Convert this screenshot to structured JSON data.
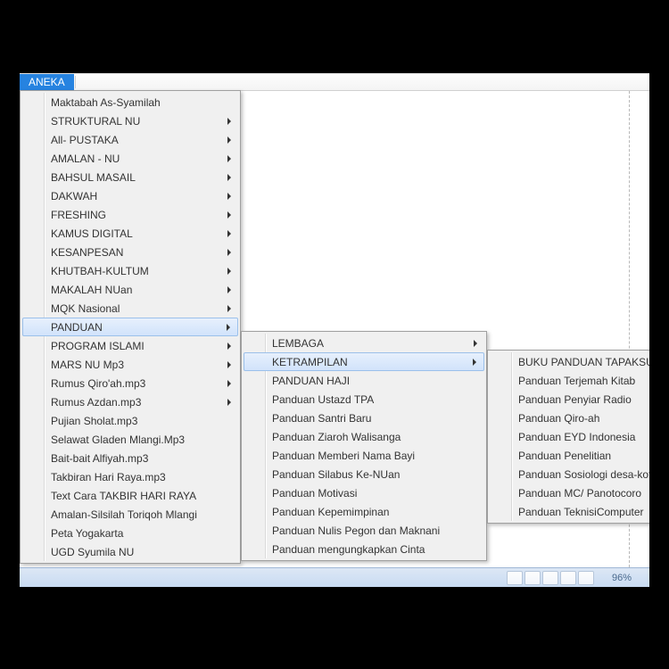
{
  "menubar": {
    "active": "ANEKA"
  },
  "menu1": {
    "items": [
      {
        "label": "Maktabah As-Syamilah",
        "arrow": false
      },
      {
        "label": "STRUKTURAL NU",
        "arrow": true
      },
      {
        "label": "All- PUSTAKA",
        "arrow": true
      },
      {
        "label": "AMALAN - NU",
        "arrow": true
      },
      {
        "label": "BAHSUL MASAIL",
        "arrow": true
      },
      {
        "label": "DAKWAH",
        "arrow": true
      },
      {
        "label": "FRESHING",
        "arrow": true
      },
      {
        "label": "KAMUS DIGITAL",
        "arrow": true
      },
      {
        "label": "KESANPESAN",
        "arrow": true
      },
      {
        "label": "KHUTBAH-KULTUM",
        "arrow": true
      },
      {
        "label": "MAKALAH NUan",
        "arrow": true
      },
      {
        "label": "MQK Nasional",
        "arrow": true
      },
      {
        "label": "PANDUAN",
        "arrow": true,
        "highlight": true
      },
      {
        "label": "PROGRAM ISLAMI",
        "arrow": true
      },
      {
        "label": "MARS NU Mp3",
        "arrow": true
      },
      {
        "label": "Rumus Qiro'ah.mp3",
        "arrow": true
      },
      {
        "label": "Rumus Azdan.mp3",
        "arrow": true
      },
      {
        "label": "Pujian Sholat.mp3",
        "arrow": false
      },
      {
        "label": "Selawat Gladen Mlangi.Mp3",
        "arrow": false
      },
      {
        "label": "Bait-bait Alfiyah.mp3",
        "arrow": false
      },
      {
        "label": "Takbiran Hari Raya.mp3",
        "arrow": false
      },
      {
        "label": "Text Cara TAKBIR HARI RAYA",
        "arrow": false
      },
      {
        "label": "Amalan-Silsilah Toriqoh Mlangi",
        "arrow": false
      },
      {
        "label": "Peta Yogakarta",
        "arrow": false
      },
      {
        "label": "UGD Syumila NU",
        "arrow": false
      }
    ]
  },
  "menu2": {
    "items": [
      {
        "label": "LEMBAGA",
        "arrow": true
      },
      {
        "label": "KETRAMPILAN",
        "arrow": true,
        "highlight": true
      },
      {
        "label": "PANDUAN HAJI",
        "arrow": false
      },
      {
        "label": "Panduan Ustazd TPA",
        "arrow": false
      },
      {
        "label": "Panduan Santri Baru",
        "arrow": false
      },
      {
        "label": "Panduan Ziaroh Walisanga",
        "arrow": false
      },
      {
        "label": "Panduan Memberi Nama Bayi",
        "arrow": false
      },
      {
        "label": "Panduan Silabus Ke-NUan",
        "arrow": false
      },
      {
        "label": "Panduan Motivasi",
        "arrow": false
      },
      {
        "label": "Panduan Kepemimpinan",
        "arrow": false
      },
      {
        "label": "Panduan Nulis Pegon dan Maknani",
        "arrow": false
      },
      {
        "label": "Panduan mengungkapkan Cinta",
        "arrow": false
      }
    ]
  },
  "menu3": {
    "items": [
      {
        "label": "BUKU PANDUAN TAPAKSUCI",
        "arrow": false
      },
      {
        "label": "Panduan Terjemah Kitab",
        "arrow": false
      },
      {
        "label": "Panduan Penyiar Radio",
        "arrow": false
      },
      {
        "label": "Panduan Qiro-ah",
        "arrow": false
      },
      {
        "label": "Panduan EYD Indonesia",
        "arrow": false
      },
      {
        "label": "Panduan Penelitian",
        "arrow": false
      },
      {
        "label": "Panduan Sosiologi desa-kota",
        "arrow": false
      },
      {
        "label": "Panduan MC/ Panotocoro",
        "arrow": false
      },
      {
        "label": "Panduan TeknisiComputer",
        "arrow": false
      }
    ]
  },
  "status": {
    "zoom": "96%"
  }
}
